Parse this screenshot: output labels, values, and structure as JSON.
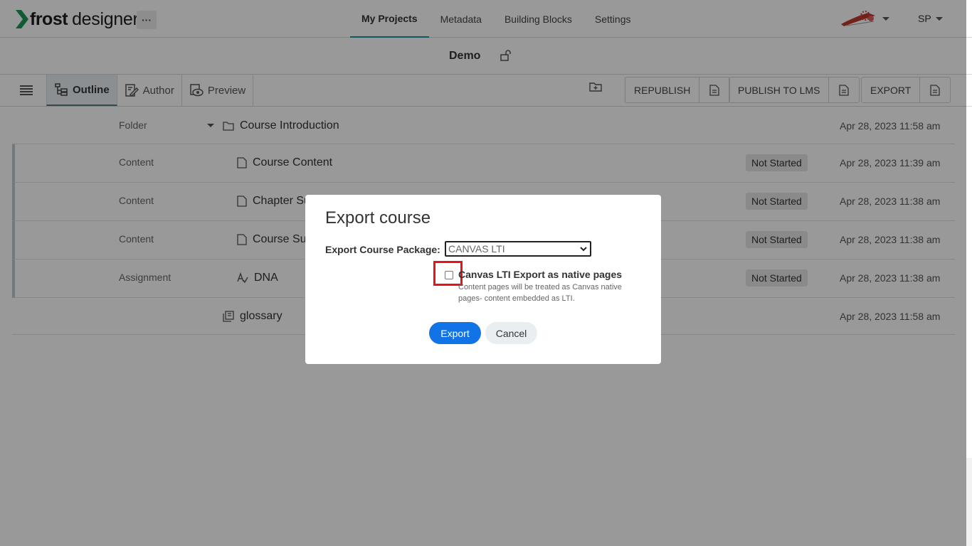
{
  "brand": {
    "name_bold": "frost",
    "name_rest": "designer",
    "more": "···"
  },
  "nav": {
    "items": [
      {
        "label": "My Projects"
      },
      {
        "label": "Metadata"
      },
      {
        "label": "Building Blocks"
      },
      {
        "label": "Settings"
      }
    ],
    "active": "My Projects"
  },
  "user": {
    "initials": "SP"
  },
  "project": {
    "title": "Demo"
  },
  "view_tabs": [
    {
      "label": "Outline",
      "icon": "outline-icon"
    },
    {
      "label": "Author",
      "icon": "author-icon"
    },
    {
      "label": "Preview",
      "icon": "preview-icon"
    }
  ],
  "actions": {
    "republish": "REPUBLISH",
    "publish_lms": "PUBLISH TO LMS",
    "export": "EXPORT"
  },
  "rows": [
    {
      "type": "Folder",
      "name": "Course Introduction",
      "status": "",
      "date": "Apr 28, 2023 11:58 am",
      "icon": "folder-icon"
    },
    {
      "type": "Content",
      "name": "Course Content",
      "status": "Not Started",
      "date": "Apr 28, 2023 11:39 am",
      "icon": "document-icon"
    },
    {
      "type": "Content",
      "name": "Chapter Su",
      "status": "Not Started",
      "date": "Apr 28, 2023 11:38 am",
      "icon": "document-icon"
    },
    {
      "type": "Content",
      "name": "Course Su",
      "status": "Not Started",
      "date": "Apr 28, 2023 11:38 am",
      "icon": "document-icon"
    },
    {
      "type": "Assignment",
      "name": "DNA",
      "status": "Not Started",
      "date": "Apr 28, 2023 11:38 am",
      "icon": "assignment-icon"
    },
    {
      "type": "",
      "name": "glossary",
      "status": "",
      "date": "Apr 28, 2023 11:58 am",
      "icon": "glossary-icon"
    }
  ],
  "modal": {
    "title": "Export course",
    "package_label": "Export Course Package:",
    "package_value": "CANVAS LTI",
    "checkbox_label": "Canvas LTI Export as native pages",
    "checkbox_help": "Content pages will be treated as Canvas native pages- content embedded as LTI.",
    "checkbox_checked": false,
    "export_label": "Export",
    "cancel_label": "Cancel"
  },
  "colors": {
    "accent": "#1a8f9b",
    "primary_button": "#1273e6",
    "highlight": "#e8131a"
  }
}
